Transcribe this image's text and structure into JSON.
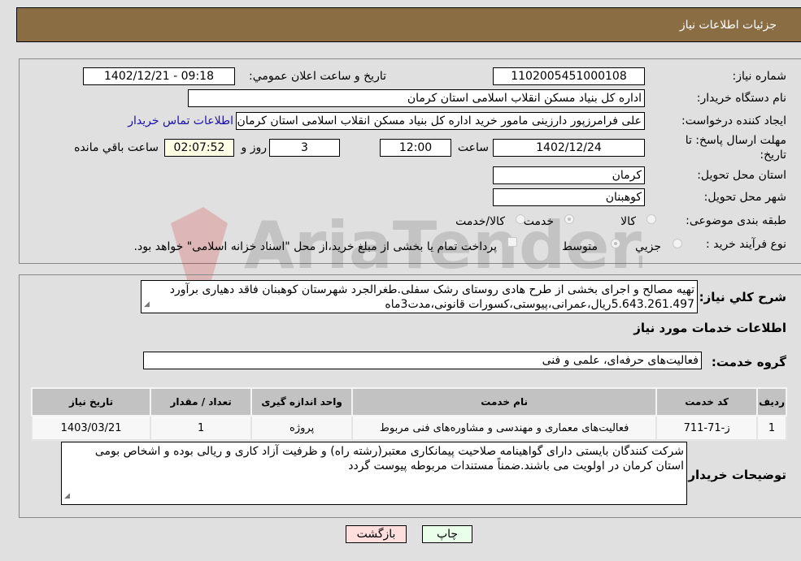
{
  "header": {
    "title": "جزئیات اطلاعات نیاز"
  },
  "form": {
    "need_number": {
      "label": "شماره نیاز:",
      "value": "1102005451000108"
    },
    "announce_datetime": {
      "label": "تاریخ و ساعت اعلان عمومي:",
      "value": "1402/12/21 - 09:18"
    },
    "buyer_org": {
      "label": "نام دستگاه خریدار:",
      "value": "اداره کل بنیاد مسکن انقلاب اسلامی استان کرمان"
    },
    "requester": {
      "label": "ایجاد کننده درخواست:",
      "value": "علی فرامرزپور دارزینی مامور خرید اداره کل بنیاد مسکن انقلاب اسلامی استان کرمان",
      "contact_link": "اطلاعات تماس خریدار"
    },
    "deadline": {
      "label_line1": "مهلت ارسال پاسخ: تا",
      "label_line2": "تاریخ:",
      "date": "1402/12/24",
      "time_label": "ساعت",
      "time": "12:00",
      "days": "3",
      "days_label": "روز و",
      "remaining": "02:07:52",
      "remaining_label": "ساعت باقي مانده"
    },
    "province": {
      "label": "استان محل تحویل:",
      "value": "کرمان"
    },
    "city": {
      "label": "شهر محل تحویل:",
      "value": "کوهبنان"
    },
    "category": {
      "label": "طبقه بندی موضوعی:",
      "options": [
        "کالا",
        "خدمت",
        "کالا/خدمت"
      ],
      "selected": "خدمت"
    },
    "process_type": {
      "label": "نوع فرآیند خرید :",
      "options": [
        "جزيي",
        "متوسط"
      ],
      "selected": "متوسط",
      "treasury_note": "پرداخت تمام یا بخشی از مبلغ خرید،از محل \"اسناد خزانه اسلامی\" خواهد بود."
    }
  },
  "description": {
    "label": "شرح کلي نیاز:",
    "value": "تهیه مصالح و اجرای بخشی از طرح هادی روستای رشک سفلی.طغرالجرد شهرستان کوهبنان فاقد دهیاری برآورد 5.643.261.497ریال،عمرانی،پیوستی،کسورات قانونی،مدت3ماه"
  },
  "services": {
    "section_title": "اطلاعات خدمات مورد نیاز",
    "group_label": "گروه خدمت:",
    "group_value": "فعالیت‌های حرفه‌ای، علمی و فنی",
    "columns": [
      "ردیف",
      "کد خدمت",
      "نام خدمت",
      "واحد اندازه گیری",
      "تعداد / مقدار",
      "تاریخ نیاز"
    ],
    "rows": [
      [
        "1",
        "ز-71-711",
        "فعالیت‌های معماری و مهندسی و مشاوره‌های فنی مربوط",
        "پروژه",
        "1",
        "1403/03/21"
      ]
    ]
  },
  "buyer_notes": {
    "label": "توضیحات خریدار:",
    "value": "شرکت کنندگان بایستی دارای گواهینامه صلاحیت پیمانکاری معتبر(رشته راه) و ظرفیت آزاد کاری و ریالی بوده و اشخاص بومی استان کرمان در اولویت می باشند.ضمناً مستندات مربوطه پیوست گردد"
  },
  "buttons": {
    "print": "چاپ",
    "back": "بازگشت"
  },
  "watermark": {
    "text": "AriaTender.neT"
  }
}
